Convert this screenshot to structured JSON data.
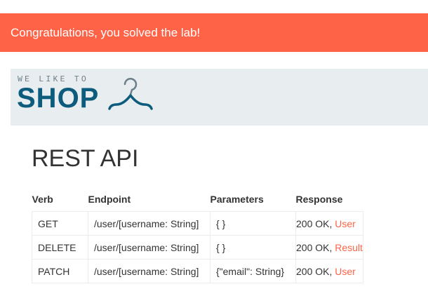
{
  "banner": {
    "message": "Congratulations, you solved the lab!"
  },
  "logo": {
    "tagline": "WE LIKE TO",
    "word": "SHOP",
    "icon": "hanger-icon"
  },
  "page": {
    "title": "REST API"
  },
  "table": {
    "headers": {
      "verb": "Verb",
      "endpoint": "Endpoint",
      "parameters": "Parameters",
      "response": "Response"
    },
    "rows": [
      {
        "verb": "GET",
        "endpoint": "/user/[username: String]",
        "parameters": "{ }",
        "status": "200 OK,",
        "link": "User"
      },
      {
        "verb": "DELETE",
        "endpoint": "/user/[username: String]",
        "parameters": "{ }",
        "status": "200 OK,",
        "link": "Result"
      },
      {
        "verb": "PATCH",
        "endpoint": "/user/[username: String]",
        "parameters": "{\"email\": String}",
        "status": "200 OK,",
        "link": "User"
      }
    ]
  },
  "colors": {
    "banner": "#ff6347",
    "header": "#e8edef",
    "logo": "#0d5c7d",
    "link": "#ff6347"
  }
}
